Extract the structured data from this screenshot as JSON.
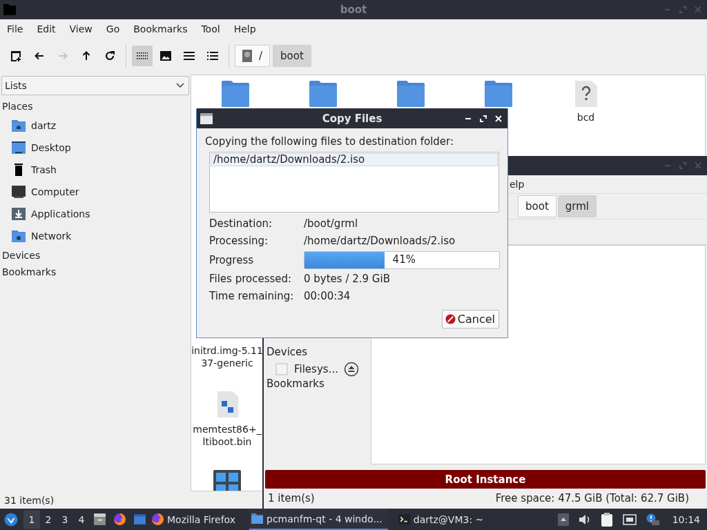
{
  "main_window": {
    "title": "boot",
    "menu": [
      "File",
      "Edit",
      "View",
      "Go",
      "Bookmarks",
      "Tool",
      "Help"
    ],
    "nav_buttons": [
      {
        "kind": "new-tab",
        "disabled": false
      },
      {
        "kind": "back",
        "disabled": false
      },
      {
        "kind": "forward",
        "disabled": true
      },
      {
        "kind": "up",
        "disabled": false
      },
      {
        "kind": "reload",
        "disabled": false
      }
    ],
    "view_buttons": [
      {
        "kind": "icons",
        "selected": true
      },
      {
        "kind": "thumbnails",
        "selected": false
      },
      {
        "kind": "compact",
        "selected": false
      },
      {
        "kind": "details",
        "selected": false
      }
    ],
    "path": [
      {
        "label": "/",
        "kind": "root",
        "selected": false
      },
      {
        "label": "boot",
        "kind": "dir",
        "selected": true
      }
    ],
    "sidebar": {
      "combo": "Lists",
      "sections": [
        {
          "label": "Places",
          "items": [
            {
              "label": "dartz",
              "kind": "home"
            },
            {
              "label": "Desktop",
              "kind": "desktop"
            },
            {
              "label": "Trash",
              "kind": "trash"
            },
            {
              "label": "Computer",
              "kind": "computer"
            },
            {
              "label": "Applications",
              "kind": "applications"
            },
            {
              "label": "Network",
              "kind": "network"
            }
          ]
        },
        {
          "label": "Devices"
        },
        {
          "label": "Bookmarks"
        }
      ]
    },
    "files_top": [
      {
        "kind": "folder"
      },
      {
        "kind": "folder"
      },
      {
        "kind": "folder"
      },
      {
        "kind": "folder"
      },
      {
        "kind": "unknown",
        "lines": [
          "bcd"
        ]
      }
    ],
    "files_column": [
      {
        "kind": "none",
        "lines": [
          "initrd.img-5.11",
          "37-generic"
        ]
      },
      {
        "kind": "binary",
        "lines": [
          "memtest86+_",
          "ltiboot.bin"
        ]
      },
      {
        "kind": "tiles"
      }
    ],
    "status": "31 item(s)"
  },
  "second_window": {
    "menu_fragment": "elp",
    "path": [
      {
        "label": "boot",
        "selected": false
      },
      {
        "label": "grml",
        "selected": true
      }
    ],
    "sidebar": [
      {
        "label": "Devices",
        "kind": "heading"
      },
      {
        "label": "Filesys...",
        "kind": "device"
      },
      {
        "label": "Bookmarks",
        "kind": "heading"
      }
    ],
    "banner": "Root Instance",
    "status_left": "1 item(s)",
    "status_right": "Free space: 47.5 GiB (Total: 62.7 GiB)"
  },
  "dialog": {
    "title": "Copy Files",
    "message": "Copying the following files to destination folder:",
    "files": [
      {
        "path": "/home/dartz/Downloads/2.iso",
        "selected": true
      }
    ],
    "rows": [
      {
        "kind": "text",
        "label": "Destination:",
        "value": "/boot/grml"
      },
      {
        "kind": "text",
        "label": "Processing:",
        "value": "/home/dartz/Downloads/2.iso"
      },
      {
        "kind": "progress",
        "label": "Progress",
        "level": 0.41,
        "value": "41%"
      },
      {
        "kind": "text",
        "label": "Files processed:",
        "value": "0 bytes / 2.9 GiB"
      },
      {
        "kind": "text",
        "label": "Time remaining:",
        "value": "00:00:34"
      }
    ],
    "cancel": "Cancel"
  },
  "taskbar": {
    "workspaces": [
      {
        "label": "1",
        "selected": true
      },
      {
        "label": "2",
        "selected": false
      },
      {
        "label": "3",
        "selected": false
      },
      {
        "label": "4",
        "selected": false
      }
    ],
    "launchers": [
      {
        "kind": "files"
      },
      {
        "kind": "browser"
      },
      {
        "kind": "window"
      }
    ],
    "tasks": [
      {
        "label": "Mozilla Firefox",
        "kind": "browser",
        "selected": false
      },
      {
        "label": "pcmanfm-qt - 4 windo...",
        "kind": "folder",
        "selected": true
      },
      {
        "label": "dartz@VM3: ~",
        "kind": "terminal",
        "selected": false
      }
    ],
    "clock": "10:14"
  }
}
